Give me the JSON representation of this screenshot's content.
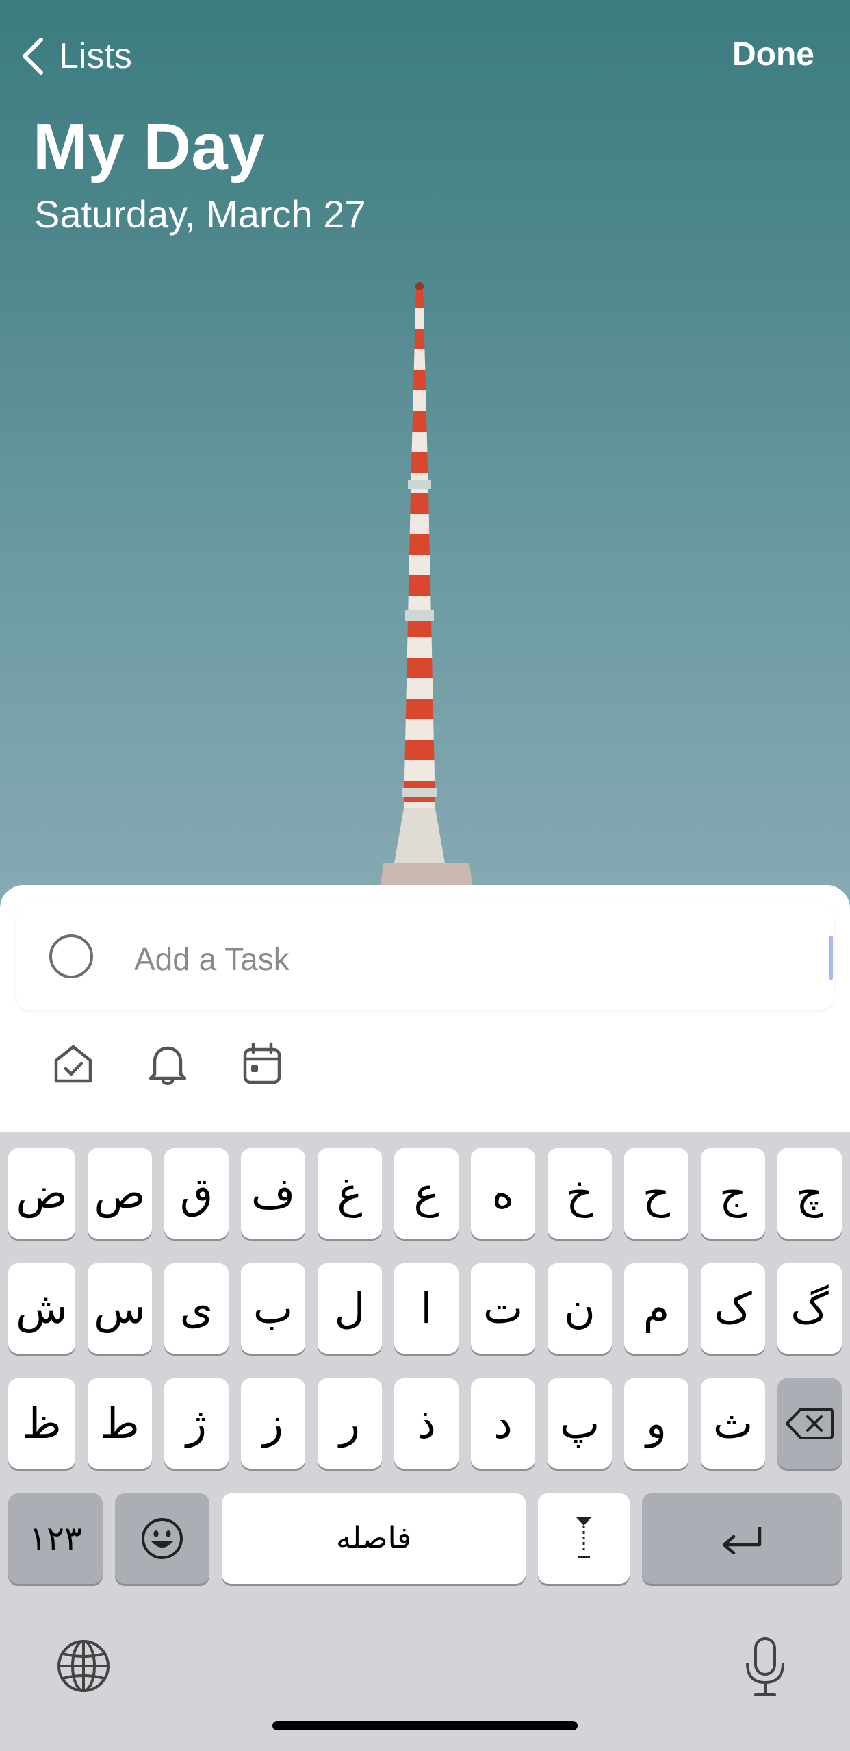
{
  "nav": {
    "back_label": "Lists",
    "done_label": "Done"
  },
  "header": {
    "title": "My Day",
    "date": "Saturday, March 27"
  },
  "task_entry": {
    "placeholder": "Add a Task"
  },
  "toolbar": {
    "icons": [
      "add-to-my-day-icon",
      "reminder-bell-icon",
      "due-date-calendar-icon"
    ]
  },
  "keyboard": {
    "row1": [
      "ض",
      "ص",
      "ق",
      "ف",
      "غ",
      "ع",
      "ه",
      "خ",
      "ح",
      "ج",
      "چ"
    ],
    "row2": [
      "ش",
      "س",
      "ی",
      "ب",
      "ل",
      "ا",
      "ت",
      "ن",
      "م",
      "ک",
      "گ"
    ],
    "row3": [
      "ظ",
      "ط",
      "ژ",
      "ز",
      "ر",
      "ذ",
      "د",
      "پ",
      "و",
      "ث"
    ],
    "numbers_label": "۱۲۳",
    "space_label": "فاصله"
  },
  "colors": {
    "accent_caret": "#a9b8ef",
    "keyboard_bg": "#d3d3d8",
    "sky_top": "#3b7c80",
    "sky_bottom": "#87aab4"
  }
}
